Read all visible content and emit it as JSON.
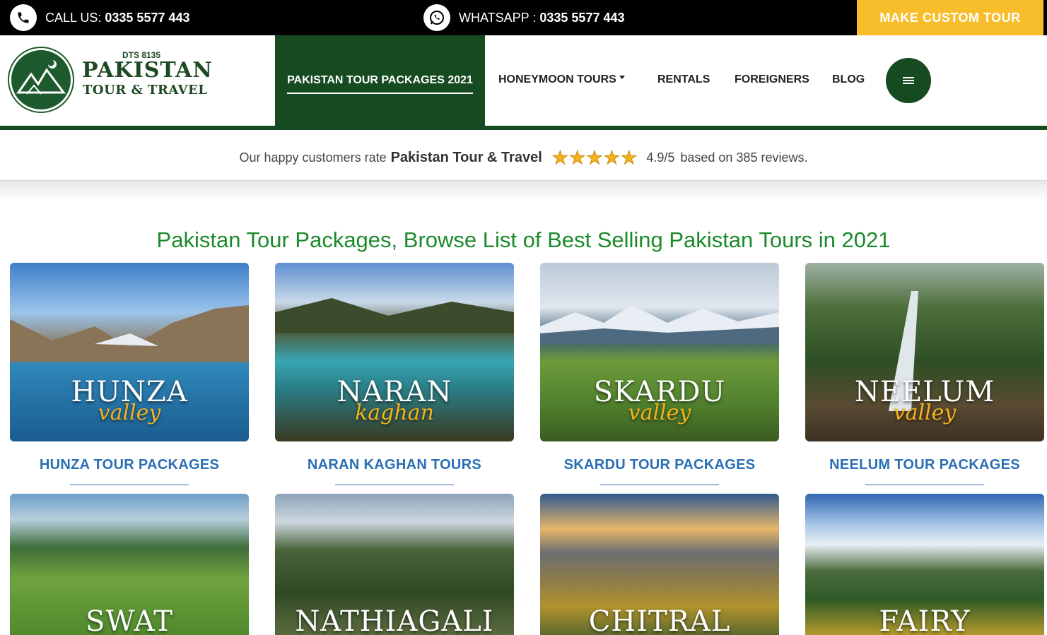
{
  "topbar": {
    "call_label": "CALL US:",
    "call_number": "0335 5577 443",
    "whatsapp_label": "WHATSAPP :",
    "whatsapp_number": "0335 5577 443",
    "custom_tour": "MAKE CUSTOM TOUR"
  },
  "logo": {
    "dts": "DTS 8135",
    "name": "PAKISTAN",
    "sub": "TOUR & TRAVEL"
  },
  "nav": {
    "active": "PAKISTAN TOUR PACKAGES 2021",
    "honeymoon": "HONEYMOON TOURS",
    "rentals": "RENTALS",
    "foreigners": "FOREIGNERS",
    "blog": "BLOG"
  },
  "rating": {
    "prefix": "Our happy customers rate",
    "brand": "Pakistan Tour & Travel",
    "score": "4.9/5",
    "suffix": "based on 385 reviews.",
    "stars": 5
  },
  "heading": "Pakistan Tour Packages, Browse List of Best Selling Pakistan Tours in 2021",
  "cards": [
    {
      "word": "HUNZA",
      "script": "valley",
      "title": "HUNZA TOUR PACKAGES"
    },
    {
      "word": "NARAN",
      "script": "kaghan",
      "title": "NARAN KAGHAN TOURS"
    },
    {
      "word": "SKARDU",
      "script": "valley",
      "title": "SKARDU TOUR PACKAGES"
    },
    {
      "word": "NEELUM",
      "script": "valley",
      "title": "NEELUM TOUR PACKAGES"
    },
    {
      "word": "SWAT",
      "script": "",
      "title": ""
    },
    {
      "word": "NATHIAGALI",
      "script": "",
      "title": ""
    },
    {
      "word": "CHITRAL",
      "script": "",
      "title": ""
    },
    {
      "word": "FAIRY",
      "script": "",
      "title": ""
    }
  ],
  "colors": {
    "brand_green": "#164a21",
    "accent_yellow": "#f7bd2b",
    "heading_green": "#1b8a2a",
    "link_blue": "#2a6fb4"
  }
}
